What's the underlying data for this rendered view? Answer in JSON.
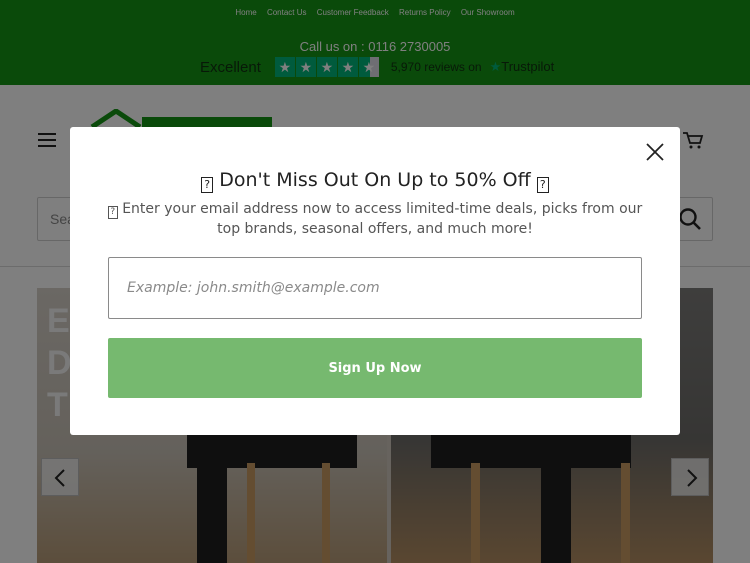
{
  "topbar": {
    "links": [
      "Home",
      "Contact Us",
      "Customer Feedback",
      "Returns Policy",
      "Our Showroom"
    ],
    "call_us": "Call us on : 0116 2730005",
    "trust_rating": "Excellent",
    "trust_reviews": "5,970 reviews on",
    "trust_brand": "Trustpilot",
    "trust_stars": 4.5,
    "brand_color": "#149414"
  },
  "header": {
    "search_placeholder": "Search"
  },
  "hero": {
    "text_lines": [
      "E",
      "D",
      "T"
    ]
  },
  "modal": {
    "title": "Don't Miss Out On Up to 50% Off",
    "subtitle": "Enter your email address now to access limited-time deals, picks from our top brands, seasonal offers, and much more!",
    "email_placeholder": "Example: john.smith@example.com",
    "email_value": "",
    "signup_label": "Sign Up Now",
    "missing_glyph": "?",
    "button_color": "#76b96f"
  }
}
